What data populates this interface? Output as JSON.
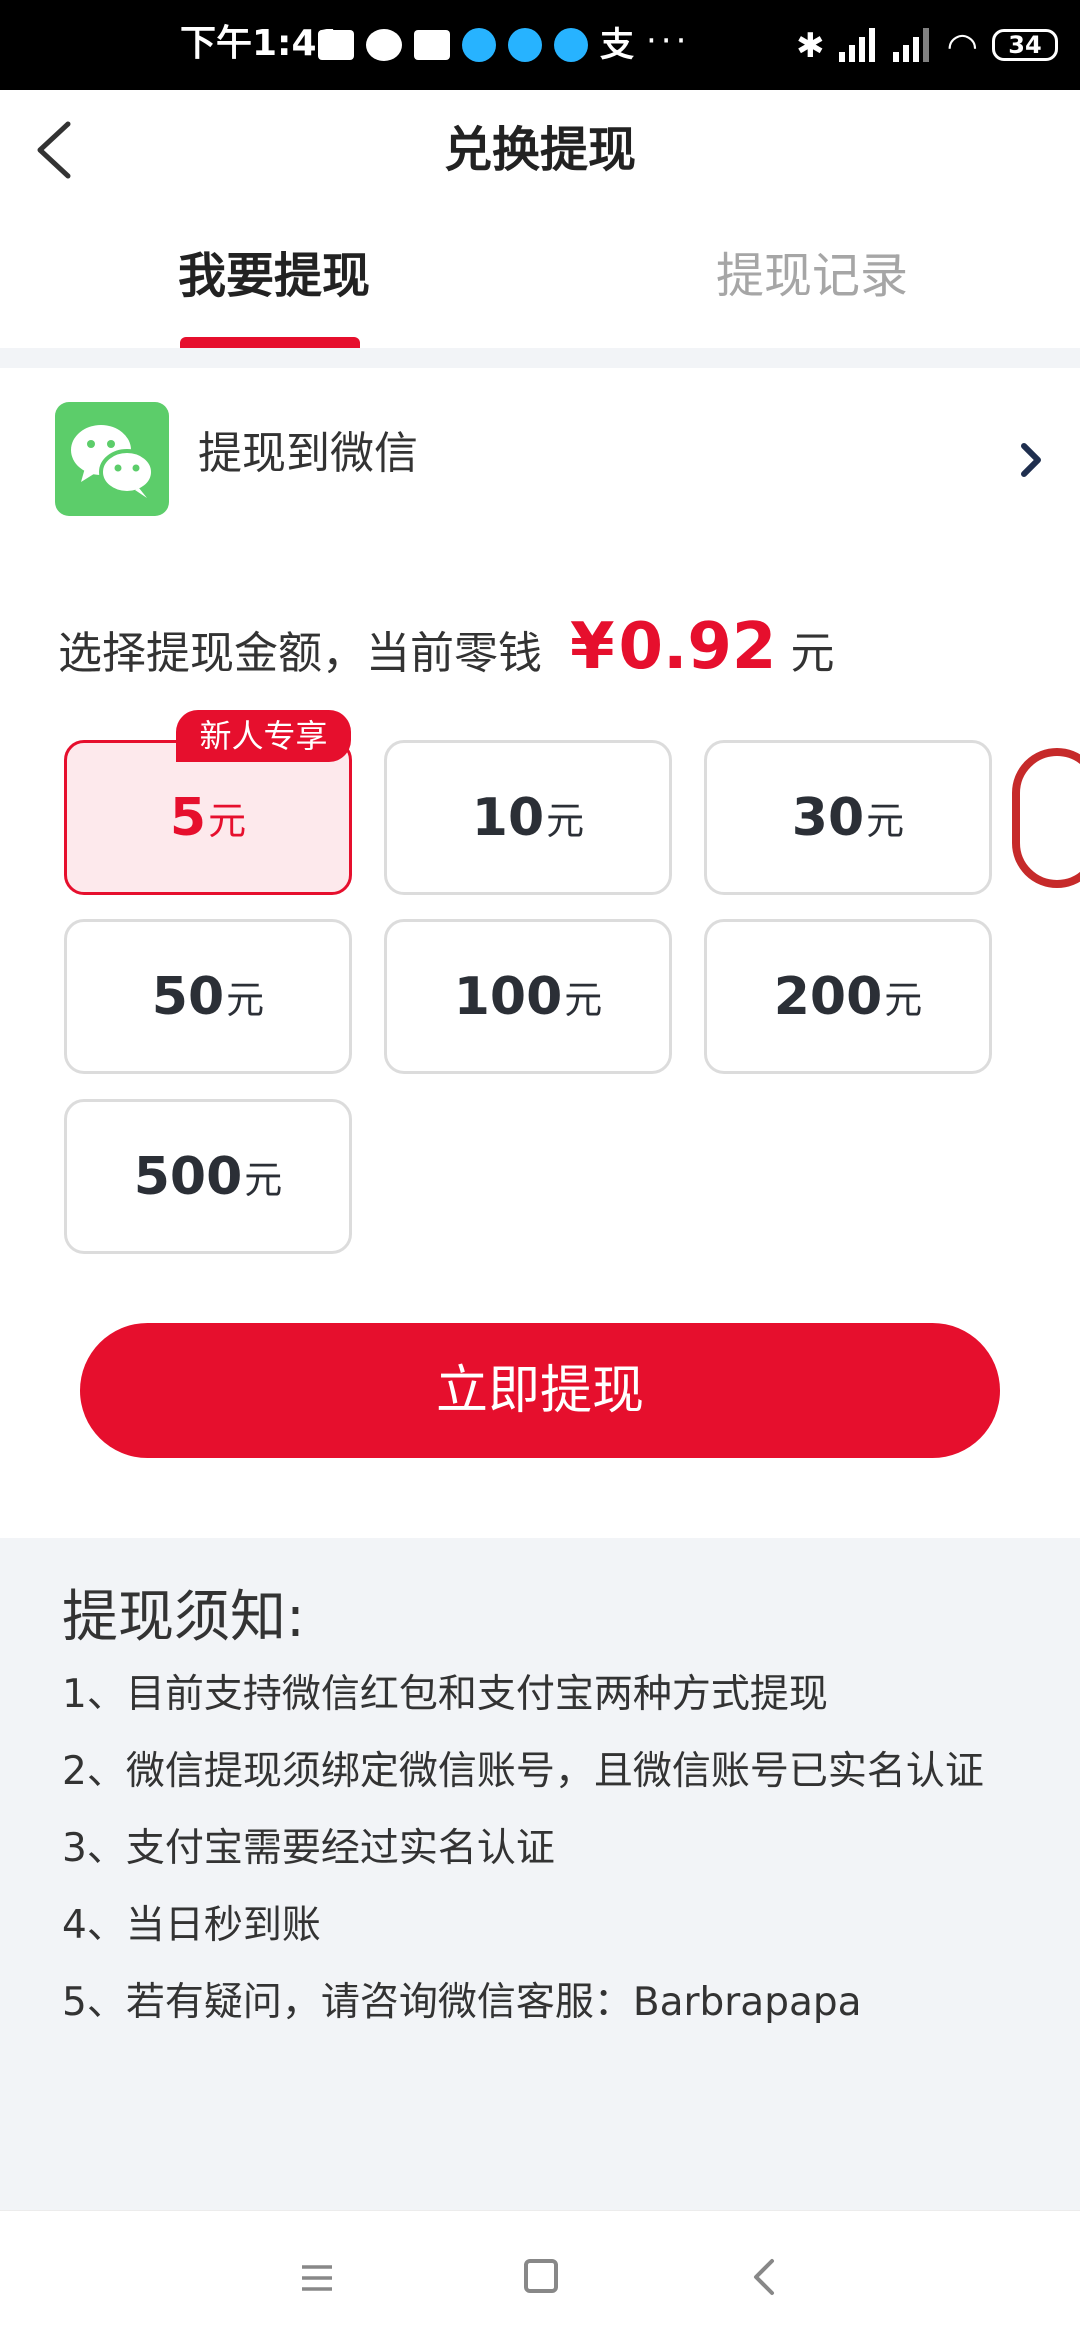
{
  "status_bar": {
    "time": "下午1:41",
    "zhifubao_glyph": "支",
    "overflow": "···",
    "bluetooth": "✱",
    "wifi": "◠",
    "battery": "34"
  },
  "header": {
    "title": "兑换提现"
  },
  "tabs": [
    {
      "label": "我要提现",
      "active": true
    },
    {
      "label": "提现记录",
      "active": false
    }
  ],
  "wechat": {
    "label": "提现到微信"
  },
  "amount": {
    "prefix": "选择提现金额，当前零钱",
    "symbol": "¥",
    "value": "0.92",
    "unit": "元"
  },
  "badge": "新人专享",
  "options": [
    {
      "num": "5",
      "unit": "元",
      "selected": true
    },
    {
      "num": "10",
      "unit": "元"
    },
    {
      "num": "30",
      "unit": "元"
    },
    {
      "num": "50",
      "unit": "元"
    },
    {
      "num": "100",
      "unit": "元"
    },
    {
      "num": "200",
      "unit": "元"
    },
    {
      "num": "500",
      "unit": "元"
    }
  ],
  "submit_label": "立即提现",
  "notice": {
    "title": "提现须知:",
    "items": [
      "1、目前支持微信红包和支付宝两种方式提现",
      "2、微信提现须绑定微信账号，且微信账号已实名认证",
      "3、支付宝需要经过实名认证",
      "4、当日秒到账",
      "5、若有疑问，请咨询微信客服：Barbrapapa"
    ]
  },
  "colors": {
    "accent": "#e60f2d",
    "selected_bg": "#fde9ec",
    "wechat_green": "#5ccd6a",
    "section_bg": "#f2f4f7"
  }
}
